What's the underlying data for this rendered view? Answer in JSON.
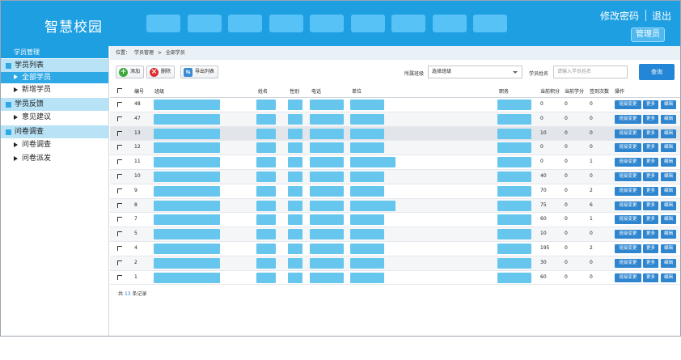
{
  "app": {
    "title": "智慧校园"
  },
  "header": {
    "change_password": "修改密码",
    "logout": "退出",
    "role": "管理员",
    "nav_count": 9
  },
  "sidebar": {
    "top_label": "学员管理",
    "sections": [
      {
        "label": "学员列表",
        "items": [
          {
            "label": "全部学员",
            "active": true
          },
          {
            "label": "新增学员",
            "active": false
          }
        ]
      },
      {
        "label": "学员反馈",
        "items": [
          {
            "label": "意见建议",
            "active": false
          }
        ]
      },
      {
        "label": "问卷调查",
        "items": [
          {
            "label": "问卷调查",
            "active": false
          },
          {
            "label": "问卷派发",
            "active": false
          }
        ]
      }
    ]
  },
  "breadcrumb": {
    "prefix": "位置：",
    "parent": "学员管理",
    "separator": ">",
    "current": "全部学员"
  },
  "toolbar": {
    "add_label": "添加",
    "delete_label": "删除",
    "export_label": "导出列表",
    "class_filter_label": "所属班级",
    "class_select_value": "选择班级",
    "name_filter_label": "学员姓名",
    "name_input_placeholder": "请输入学员姓名",
    "query_label": "查询"
  },
  "table": {
    "columns": [
      "编号",
      "班级",
      "姓名",
      "性别",
      "电话",
      "单位",
      "职务",
      "当前积分",
      "当前学分",
      "签到次数",
      "操作"
    ],
    "rows": [
      {
        "id": "48",
        "score": "0",
        "credit": "0",
        "checkins": "0"
      },
      {
        "id": "47",
        "score": "0",
        "credit": "0",
        "checkins": "0"
      },
      {
        "id": "13",
        "score": "10",
        "credit": "0",
        "checkins": "0"
      },
      {
        "id": "12",
        "score": "0",
        "credit": "0",
        "checkins": "0"
      },
      {
        "id": "11",
        "score": "0",
        "credit": "0",
        "checkins": "1"
      },
      {
        "id": "10",
        "score": "40",
        "credit": "0",
        "checkins": "0"
      },
      {
        "id": "9",
        "score": "70",
        "credit": "0",
        "checkins": "2"
      },
      {
        "id": "8",
        "score": "75",
        "credit": "0",
        "checkins": "6"
      },
      {
        "id": "7",
        "score": "60",
        "credit": "0",
        "checkins": "1"
      },
      {
        "id": "5",
        "score": "10",
        "credit": "0",
        "checkins": "0"
      },
      {
        "id": "4",
        "score": "195",
        "credit": "0",
        "checkins": "2"
      },
      {
        "id": "2",
        "score": "30",
        "credit": "0",
        "checkins": "0"
      },
      {
        "id": "1",
        "score": "60",
        "credit": "0",
        "checkins": "0"
      }
    ],
    "actions": {
      "change_class": "班级变更",
      "more": "更多",
      "edit": "编辑"
    }
  },
  "footer": {
    "prefix": "共",
    "count": "13",
    "suffix": "条记录"
  },
  "colors": {
    "header": "#1e9fe2",
    "accent": "#2386d6",
    "redacted_cell": "#67c6ee"
  }
}
